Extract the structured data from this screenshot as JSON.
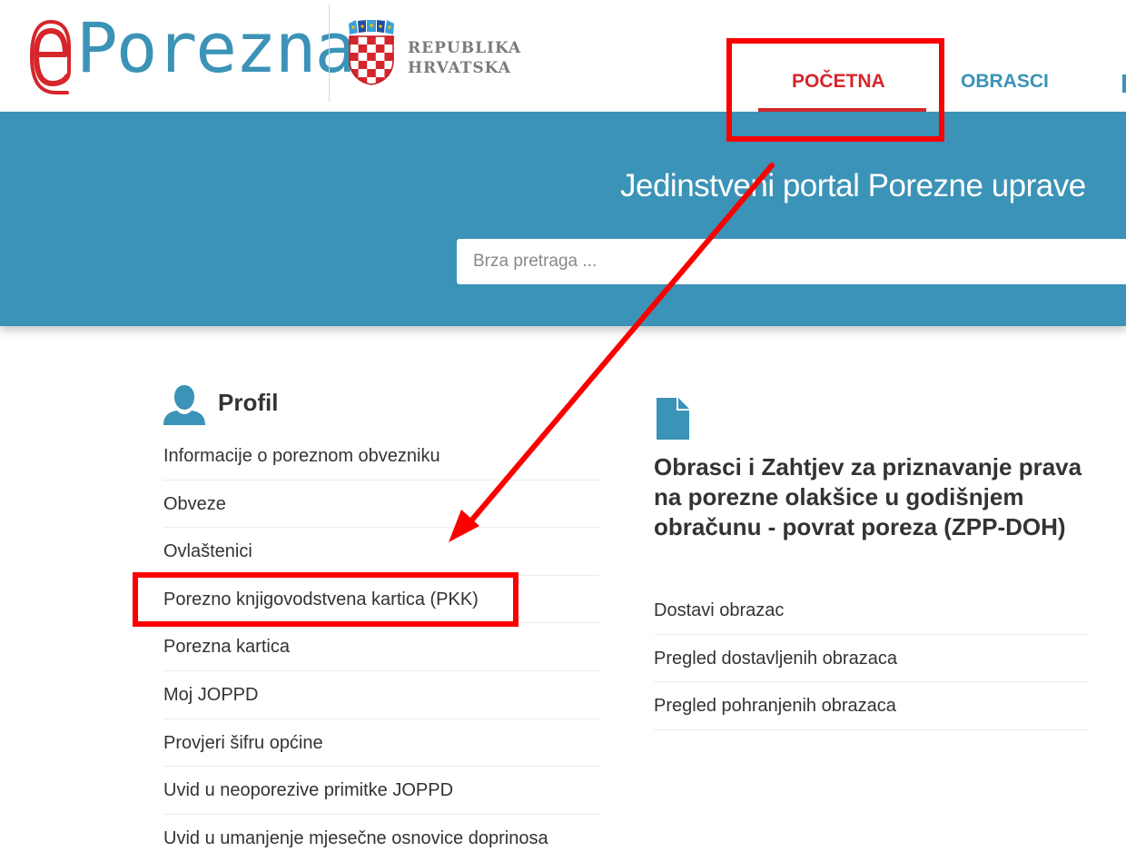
{
  "header": {
    "logo_letter": "e",
    "logo_text": "Porezna",
    "republic_line1": "REPUBLIKA",
    "republic_line2": "HRVATSKA"
  },
  "nav": {
    "items": [
      {
        "label": "POČETNA",
        "active": true
      },
      {
        "label": "OBRASCI",
        "active": false
      }
    ]
  },
  "banner": {
    "title": "Jedinstveni portal Porezne uprave",
    "search_placeholder": "Brza pretraga ..."
  },
  "profile": {
    "title": "Profil",
    "links": [
      "Informacije o poreznom obvezniku",
      "Obveze",
      "Ovlaštenici",
      "Porezno knjigovodstvena kartica (PKK)",
      "Porezna kartica",
      "Moj JOPPD",
      "Provjeri šifru općine",
      "Uvid u neoporezive primitke JOPPD",
      "Uvid u umanjenje mjesečne osnovice doprinosa"
    ]
  },
  "forms": {
    "title": "Obrasci i Zahtjev za priznavanje prava na porezne olakšice u godišnjem obračunu - povrat poreza (ZPP-DOH)",
    "links": [
      "Dostavi obrazac",
      "Pregled dostavljenih obrazaca",
      "Pregled pohranjenih obrazaca"
    ]
  },
  "colors": {
    "brand_blue": "#3b93b7",
    "brand_red": "#d5262b",
    "annotation_red": "#fc0000"
  }
}
